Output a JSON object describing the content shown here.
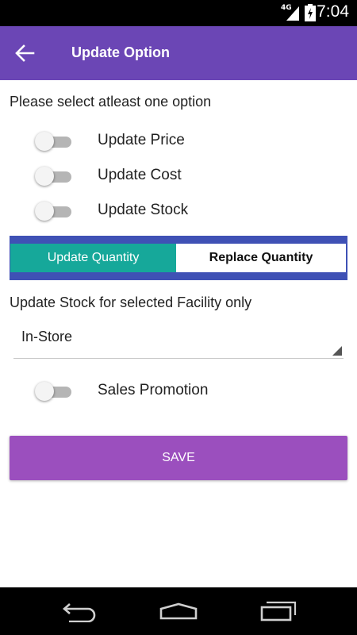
{
  "status_bar": {
    "time": "7:04",
    "network": "4G"
  },
  "app_bar": {
    "title": "Update Option"
  },
  "prompt": "Please select atleast one option",
  "options": [
    {
      "label": "Update Price",
      "checked": false
    },
    {
      "label": "Update Cost",
      "checked": false
    },
    {
      "label": "Update Stock",
      "checked": false
    }
  ],
  "stock_mode": {
    "selected": "Update Quantity",
    "left": "Update Quantity",
    "right": "Replace Quantity"
  },
  "facility": {
    "label": "Update Stock for selected Facility only",
    "selected": "In-Store"
  },
  "sales_promotion": {
    "label": "Sales Promotion",
    "checked": false
  },
  "save_label": "SAVE",
  "colors": {
    "app_bar": "#6b46b5",
    "segment_active": "#16a89a",
    "segment_border": "#3f51b5",
    "save_button": "#9b4fbe"
  }
}
